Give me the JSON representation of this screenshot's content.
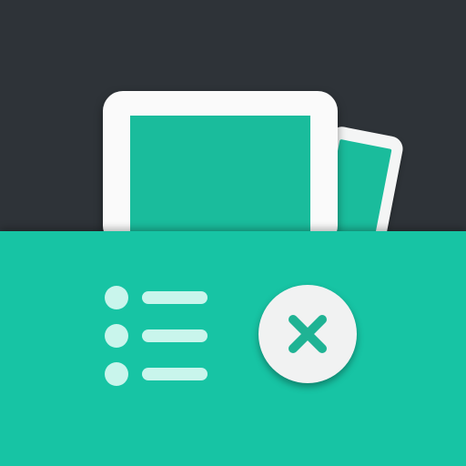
{
  "icon": {
    "name": "gallery-list-close",
    "colors": {
      "dark_background": "#2e3338",
      "teal": "#1abc9c",
      "teal_panel": "#17c4a4",
      "card_white": "#fafafa",
      "list_light": "#c9f5ec",
      "close_mark": "#1fb394"
    },
    "glyphs": [
      "image-card-icon",
      "image-card-back-icon",
      "list-icon",
      "close-icon"
    ]
  }
}
